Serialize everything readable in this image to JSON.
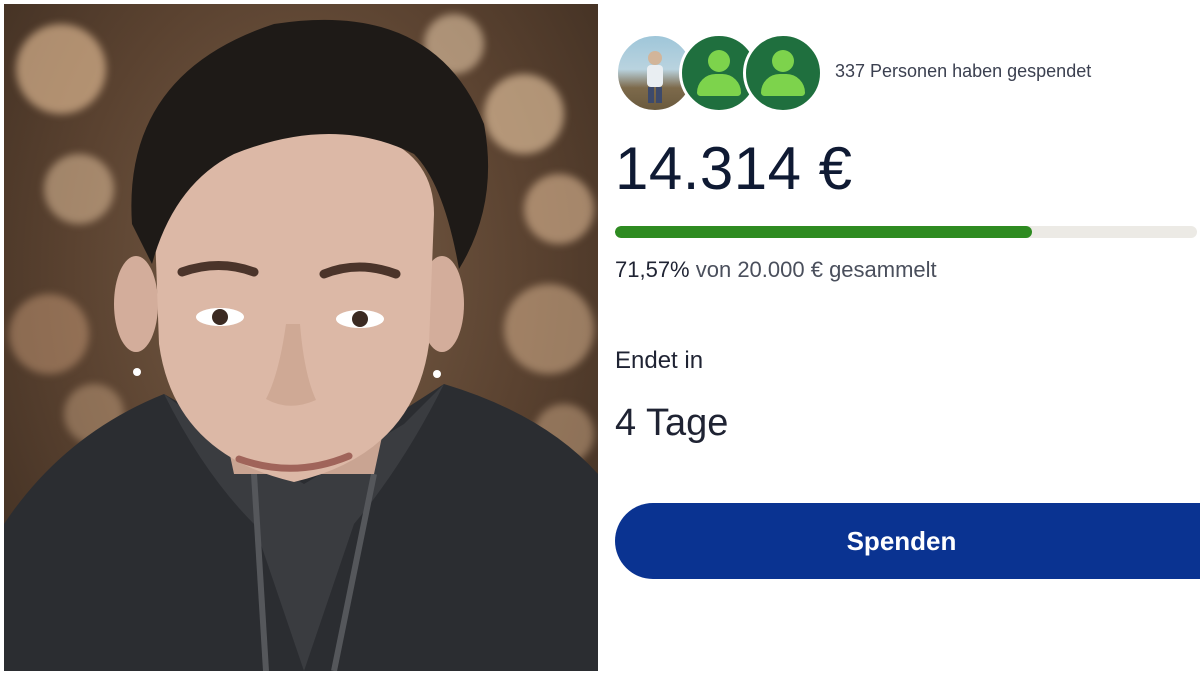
{
  "photo": {
    "alt": "Portrait photo"
  },
  "donors": {
    "count_text": "337 Personen haben gespendet",
    "avatars": [
      "photo-avatar",
      "person-icon",
      "person-icon"
    ]
  },
  "campaign": {
    "amount_raised": "14.314 €",
    "progress": {
      "fraction": 0.7157,
      "percent_text": "71,57%",
      "rest_text": " von 20.000 € gesammelt"
    },
    "ends_label": "Endet in",
    "ends_value": "4 Tage",
    "donate_label": "Spenden"
  },
  "colors": {
    "progress_fill": "#2e8b21",
    "button_bg": "#0a3391",
    "avatar_green": "#1f6f3e",
    "person_icon": "#7dd34c"
  }
}
